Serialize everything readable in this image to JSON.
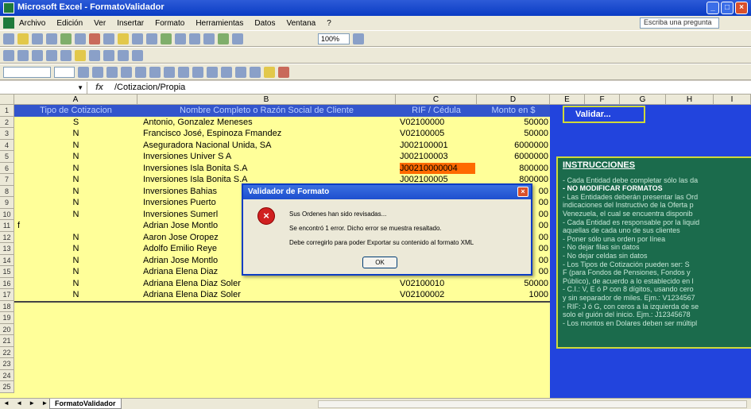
{
  "window": {
    "title": "Microsoft Excel - FormatoValidador"
  },
  "menu": [
    "Archivo",
    "Edición",
    "Ver",
    "Insertar",
    "Formato",
    "Herramientas",
    "Datos",
    "Ventana",
    "?"
  ],
  "help_box": {
    "placeholder": "Escriba una pregunta"
  },
  "toolbar": {
    "zoom": "100%"
  },
  "formula_bar": {
    "fx": "fx",
    "formula": "/Cotizacion/Propia"
  },
  "columns": [
    "A",
    "B",
    "C",
    "D",
    "E",
    "F",
    "G",
    "H",
    "I"
  ],
  "rows": [
    "1",
    "2",
    "3",
    "4",
    "5",
    "6",
    "7",
    "8",
    "9",
    "10",
    "11",
    "12",
    "13",
    "14",
    "15",
    "16",
    "17",
    "18",
    "19",
    "20",
    "21",
    "22",
    "23",
    "24",
    "25"
  ],
  "header_row": [
    "Tipo de Cotizacion",
    "Nombre Completo o Razón Social de Cliente",
    "RIF / Cédula",
    "Monto en $"
  ],
  "data_rows": [
    {
      "a": "S",
      "b": "Antonio,  Gonzalez Meneses",
      "c": "V02100000",
      "d": "50000"
    },
    {
      "a": "N",
      "b": "Francisco José, Espinoza Fmandez",
      "c": "V02100005",
      "d": "50000"
    },
    {
      "a": "N",
      "b": "Aseguradora Nacional Unida, SA",
      "c": "J002100001",
      "d": "6000000"
    },
    {
      "a": "N",
      "b": "Inversiones Univer S A",
      "c": "J002100003",
      "d": "6000000"
    },
    {
      "a": "N",
      "b": "Inversiones Isla Bonita S.A",
      "c": "J00210000004",
      "d": "800000"
    },
    {
      "a": "N",
      "b": "Inversiones Isla Bonita S.A",
      "c": "J002100005",
      "d": "800000"
    },
    {
      "a": "N",
      "b": "Inversiones Bahias",
      "c": "",
      "d": "00"
    },
    {
      "a": "N",
      "b": "Inversiones Puerto",
      "c": "",
      "d": "00"
    },
    {
      "a": "N",
      "b": "Inversiones Sumerl",
      "c": "",
      "d": "00"
    },
    {
      "a": "f",
      "b": "Adrian Jose Montlo",
      "c": "",
      "d": "00"
    },
    {
      "a": "N",
      "b": "Aaron Jose Oropez",
      "c": "",
      "d": "00"
    },
    {
      "a": "N",
      "b": "Adolfo Emilio Reye",
      "c": "",
      "d": "00"
    },
    {
      "a": "N",
      "b": "Adrian Jose Montlo",
      "c": "",
      "d": "00"
    },
    {
      "a": "N",
      "b": "Adriana Elena Diaz",
      "c": "",
      "d": "00"
    },
    {
      "a": "N",
      "b": "Adriana Elena Diaz Soler",
      "c": "V02100010",
      "d": "50000"
    },
    {
      "a": "N",
      "b": "Adriana Elena Diaz Soler",
      "c": "V02100002",
      "d": "1000"
    }
  ],
  "validate_button": "Validar...",
  "instructions": {
    "title": "INSTRUCCIONES",
    "lines": [
      "- Cada Entidad debe completar sólo las da",
      "- NO MODIFICAR FORMATOS",
      "- Las Entidades deberán presentar las Ord",
      "  indicaciones del Instructivo de la Oferta p",
      "  Venezuela, el cual se encuentra disponib",
      "- Cada Entidad es responsable por la liquid",
      "  aquellas de cada uno de sus clientes",
      "- Poner sólo una orden por línea",
      "- No dejar filas sin datos",
      "- No dejar celdas sin datos",
      "- Los Tipos de Cotización pueden ser: S",
      "  F (para Fondos de Pensiones, Fondos y",
      "  Público), de acuerdo a lo establecido en l",
      "- C.I.: V, E ó P con 8 dígitos, usando cero",
      "  y sin separador de miles. Ejm.: V1234567",
      "- RIF: J ó G, con ceros a la izquierda de se",
      "  solo el guión del inicio. Ejm.: J12345678",
      "- Los montos en Dolares deben ser múltipl"
    ]
  },
  "sheet_tab": "FormatoValidador",
  "dialog": {
    "title": "Validador de Formato",
    "line1": "Sus Ordenes han sido revisadas...",
    "line2": "Se encontró 1 error. Dicho error se muestra resaltado.",
    "line3": "Debe corregirlo para poder Exportar su contenido al formato XML",
    "ok": "OK"
  },
  "colors": {
    "sheet_bg": "#ffff99",
    "header_bg": "#3355cc",
    "panel_bg": "#2244dd",
    "error_cell": "#ff6a00"
  }
}
